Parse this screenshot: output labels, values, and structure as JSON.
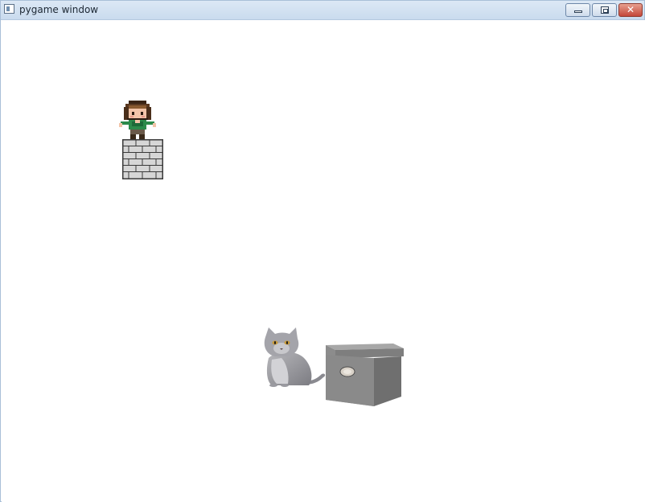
{
  "window": {
    "title": "pygame window",
    "controls": {
      "minimize": "minimize",
      "maximize": "maximize",
      "close": "✕"
    }
  },
  "scene": {
    "background": "#ffffff",
    "sprites": [
      {
        "name": "player",
        "icon": "pixel-girl-icon"
      },
      {
        "name": "brick-block",
        "icon": "brick-wall-icon"
      },
      {
        "name": "cat",
        "icon": "grey-cat-icon"
      },
      {
        "name": "storage-box",
        "icon": "grey-box-icon"
      }
    ]
  }
}
